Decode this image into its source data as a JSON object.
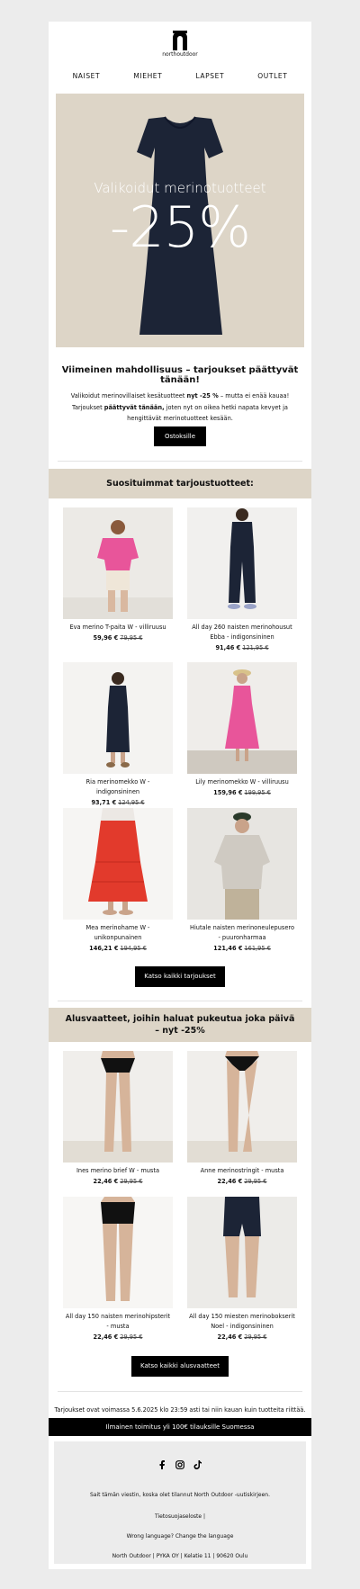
{
  "brand": {
    "name": "northoutdoor"
  },
  "nav": {
    "items": [
      "NAISET",
      "MIEHET",
      "LAPSET",
      "OUTLET"
    ]
  },
  "hero": {
    "subtitle": "Valikoidut merinotuotteet",
    "discount": "-25%"
  },
  "intro": {
    "headline": "Viimeinen mahdollisuus  – tarjoukset päättyvät tänään!",
    "text_1": "Valikoidut merinovillaiset kesätuotteet ",
    "text_2": "nyt -25 %",
    "text_3": " – mutta ei enää kauaa! Tarjoukset ",
    "text_4": "päättyvät tänään,",
    "text_5": " joten nyt on oikea hetki napata kevyet ja hengittävät merinotuotteet kesään.",
    "cta": "Ostoksille"
  },
  "offers": {
    "title": "Suosituimmat tarjoustuotteet:",
    "products": [
      {
        "name": "Eva merino T-paita W - villiruusu",
        "price": "59,96 €",
        "old": "79,95 €"
      },
      {
        "name": "All day 260 naisten merinohousut Ebba - indigonsininen",
        "price": "91,46 €",
        "old": "121,95 €"
      },
      {
        "name": "Ria merinomekko W - indigonsininen",
        "price": "93,71 €",
        "old": "124,95 €"
      },
      {
        "name": "Lily merinomekko W - villiruusu",
        "price": "159,96 €",
        "old": "199,95 €"
      },
      {
        "name": "Mea merinohame W - unikonpunainen",
        "price": "146,21 €",
        "old": "194,95 €"
      },
      {
        "name": "Hiutale naisten merinoneulepusero - puuronharmaa",
        "price": "121,46 €",
        "old": "161,95 €"
      }
    ],
    "cta": "Katso kaikki tarjoukset"
  },
  "underwear": {
    "title_1": "Alusvaatteet, joihin haluat pukeutua joka päivä",
    "title_2": "– nyt -25%",
    "products": [
      {
        "name": "Ines merino brief W - musta",
        "price": "22,46 €",
        "old": "29,95 €"
      },
      {
        "name": "Anne merinostringit - musta",
        "price": "22,46 €",
        "old": "29,95 €"
      },
      {
        "name": "All day 150 naisten merinohipsterit - musta",
        "price": "22,46 €",
        "old": "29,95 €"
      },
      {
        "name": "All day 150 miesten merinobokserit Noel - indigonsininen",
        "price": "22,46 €",
        "old": "29,95 €"
      }
    ],
    "cta": "Katso kaikki alusvaatteet"
  },
  "validity": "Tarjoukset ovat voimassa 5.6.2025 klo 23:59 asti tai niin kauan kuin tuotteita riittää.",
  "shipping": "Ilmainen toimitus yli 100€ tilauksille Suomessa",
  "footer": {
    "reason": "Sait tämän viestin, koska olet tilannut North Outdoor -uutiskirjeen.",
    "privacy": "Tietosuojaseloste |",
    "language": "Wrong language? Change the language",
    "address": "North Outdoor | PYKA OY | Kelatie 11 | 90620 Oulu",
    "social_icons": [
      "facebook-icon",
      "instagram-icon",
      "tiktok-icon"
    ]
  },
  "colors": {
    "beige": "#ddd5c7",
    "black": "#000000",
    "pink": "#e8559a",
    "navy": "#1c2436",
    "red": "#e23a2c"
  }
}
